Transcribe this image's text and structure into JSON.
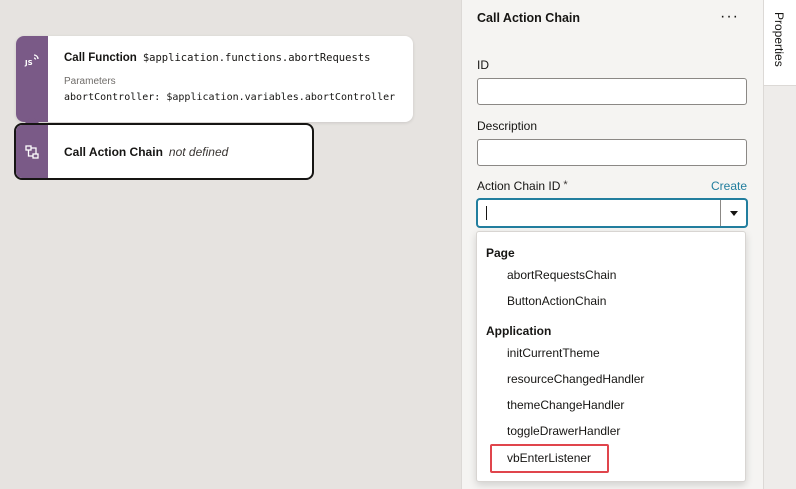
{
  "canvas": {
    "call_function": {
      "label": "Call Function",
      "function_ref": "$application.functions.abortRequests",
      "params_label": "Parameters",
      "param_name": "abortController:",
      "param_value": "$application.variables.abortController",
      "icon": "js-function-icon"
    },
    "call_action_chain": {
      "label": "Call Action Chain",
      "value": "not defined",
      "icon": "action-chain-icon"
    }
  },
  "panel": {
    "title": "Call Action Chain",
    "more_label": "···",
    "fields": {
      "id_label": "ID",
      "id_value": "",
      "description_label": "Description",
      "description_value": "",
      "chain_id_label": "Action Chain ID",
      "chain_id_required": "*",
      "create_link": "Create"
    },
    "dropdown": {
      "groups": [
        {
          "label": "Page",
          "options": [
            "abortRequestsChain",
            "ButtonActionChain"
          ]
        },
        {
          "label": "Application",
          "options": [
            "initCurrentTheme",
            "resourceChangedHandler",
            "themeChangeHandler",
            "toggleDrawerHandler",
            "vbEnterListener"
          ]
        }
      ],
      "highlighted_option": "vbEnterListener"
    }
  },
  "tabs": {
    "properties": "Properties"
  },
  "colors": {
    "stripe": "#7a5a87",
    "accent": "#227e9e",
    "highlight": "#e0454c"
  }
}
